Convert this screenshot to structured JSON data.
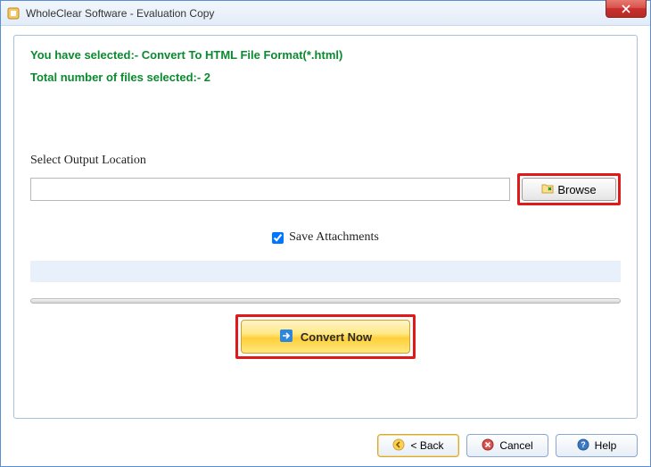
{
  "window": {
    "title": "WholeClear Software - Evaluation Copy"
  },
  "panel": {
    "selection_line": "You have selected:- Convert To HTML File Format(*.html)",
    "files_line": "Total number of files selected:- 2",
    "output_label": "Select Output Location",
    "output_value": "",
    "browse_label": "Browse",
    "save_attachments_label": "Save Attachments",
    "save_attachments_checked": true,
    "convert_label": "Convert Now"
  },
  "footer": {
    "back": "< Back",
    "cancel": "Cancel",
    "help": "Help"
  }
}
